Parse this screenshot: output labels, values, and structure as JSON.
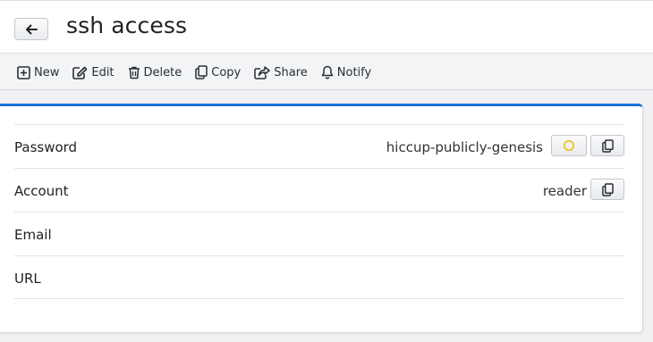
{
  "header": {
    "title": "ssh access",
    "back_icon": "arrow-left-icon"
  },
  "toolbar": {
    "items": [
      {
        "label": "New",
        "icon": "plus-square-icon"
      },
      {
        "label": "Edit",
        "icon": "edit-icon"
      },
      {
        "label": "Delete",
        "icon": "trash-icon"
      },
      {
        "label": "Copy",
        "icon": "copy-icon"
      },
      {
        "label": "Share",
        "icon": "share-icon"
      },
      {
        "label": "Notify",
        "icon": "bell-icon"
      }
    ]
  },
  "fields": [
    {
      "label": "Password",
      "value": "hiccup-publicly-genesis"
    },
    {
      "label": "Account",
      "value": "reader"
    },
    {
      "label": "Email",
      "value": ""
    },
    {
      "label": "URL",
      "value": ""
    }
  ],
  "colors": {
    "accent": "#1a73d9",
    "reveal_indicator": "#f2c230"
  }
}
